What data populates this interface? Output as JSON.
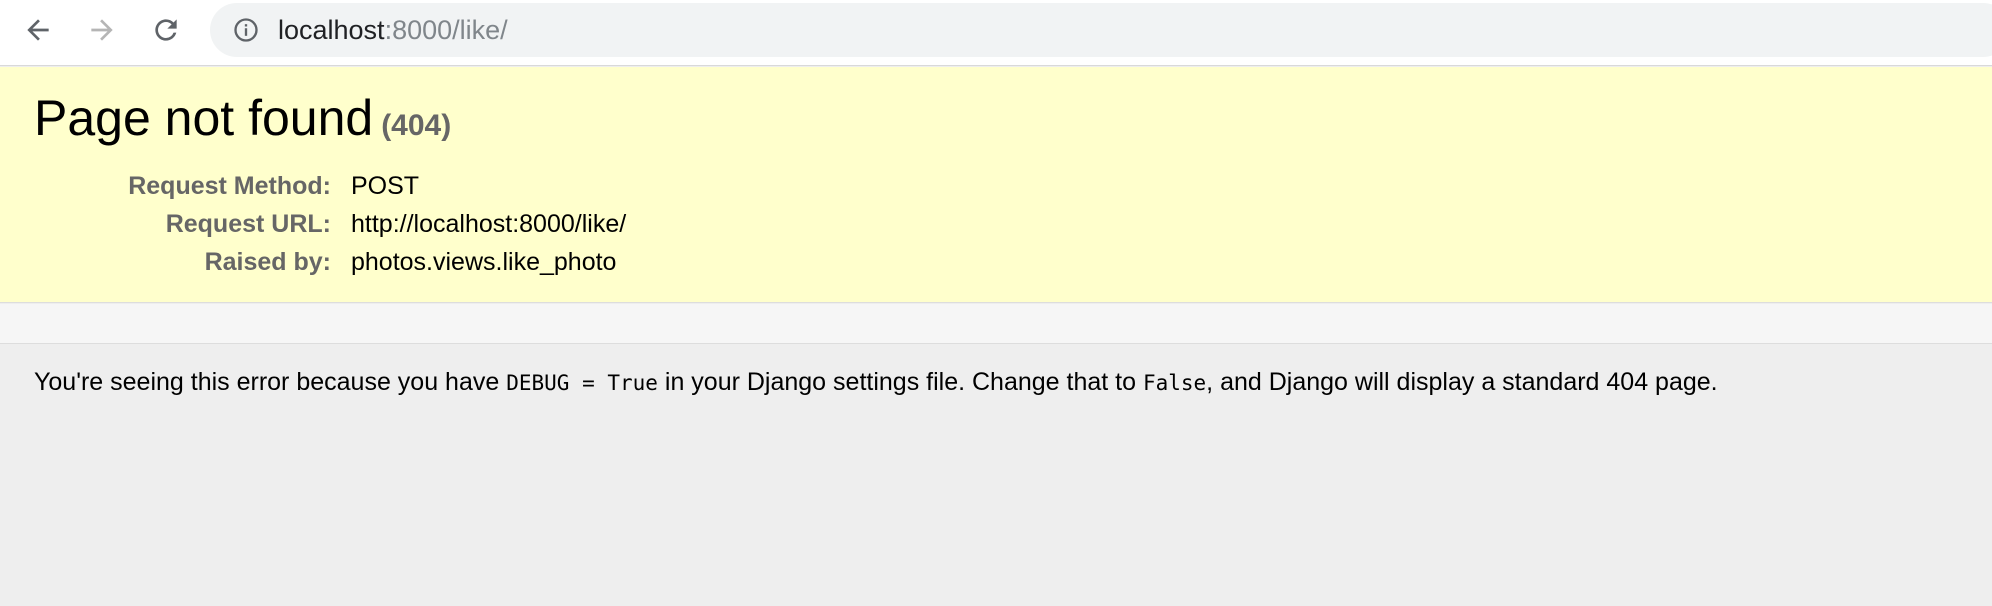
{
  "browser": {
    "url_host": "localhost",
    "url_rest": ":8000/like/"
  },
  "error": {
    "title": "Page not found",
    "status": "(404)",
    "rows": [
      {
        "label": "Request Method:",
        "value": "POST"
      },
      {
        "label": "Request URL:",
        "value": "http://localhost:8000/like/"
      },
      {
        "label": "Raised by:",
        "value": "photos.views.like_photo"
      }
    ]
  },
  "explanation": {
    "part1": "You're seeing this error because you have ",
    "code1": "DEBUG = True",
    "part2": " in your Django settings file. Change that to ",
    "code2": "False",
    "part3": ", and Django will display a standard 404 page."
  },
  "colors": {
    "summary_bg": "#ffffcc",
    "page_bg": "#eeeeee",
    "label": "#666666"
  },
  "icons": [
    "back-arrow-icon",
    "forward-arrow-icon",
    "reload-icon",
    "info-icon"
  ]
}
